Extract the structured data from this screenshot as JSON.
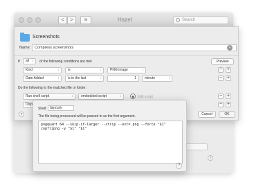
{
  "window": {
    "title": "Hazel",
    "search_placeholder": "Search",
    "back_glyph": "<",
    "forward_glyph": ">",
    "view_glyph": "≡"
  },
  "rule": {
    "folder_name": "Screenshots",
    "name_label": "Name:",
    "name_value": "Compress screenshots",
    "conditions": {
      "if_label": "If",
      "match_value": "all",
      "suffix_label": "of the following conditions are met",
      "preview_label": "Preview",
      "rows": [
        {
          "attribute": "Kind",
          "operator": "is",
          "value": "PNG image"
        },
        {
          "attribute": "Date Added",
          "operator": "is in the last",
          "amount": "1",
          "unit": "minute"
        }
      ]
    },
    "actions": {
      "label": "Do the following to the matched file or folder:",
      "action": "Run shell script",
      "script_type": "embedded script",
      "edit_label": "Edit script",
      "second_row_prefix": "Disp"
    },
    "cancel_label": "Cancel",
    "ok_label": "OK",
    "help_glyph": "?"
  },
  "script": {
    "shell_label": "Shell:",
    "shell_value": "/bin/zsh",
    "description": "The file being processed will be passed in as the first argument.",
    "line1": "pngquant 64 --skip-if-larger --strip --ext=.png --force \"$1\"",
    "line2": "zopflipng -y \"$1\" \"$1\"",
    "help_glyph": "?"
  },
  "colors": {
    "folder": "#5aa9e6",
    "window_bg": "#ebebeb"
  }
}
